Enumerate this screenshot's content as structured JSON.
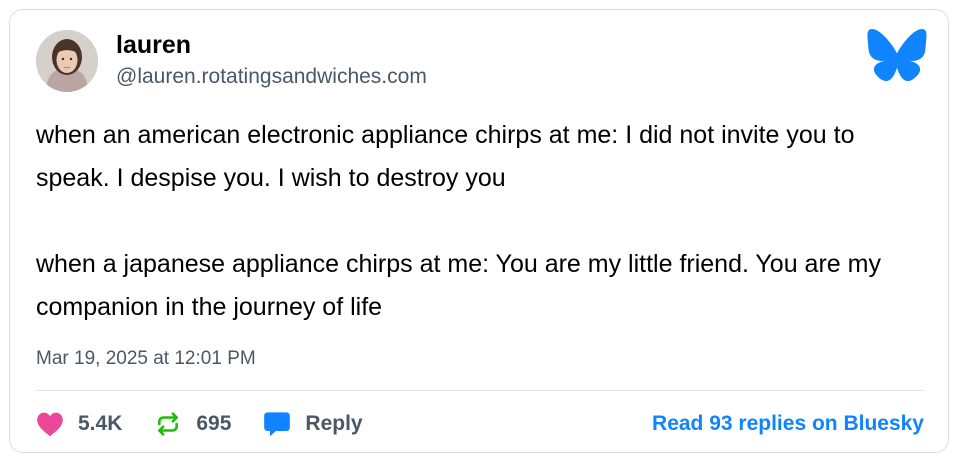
{
  "author": {
    "display_name": "lauren",
    "handle": "@lauren.rotatingsandwiches.com"
  },
  "post": {
    "paragraph_1": "when an american electronic appliance chirps at me: I did not invite you to speak. I despise you. I wish to destroy you",
    "paragraph_2": "when a japanese appliance chirps at me: You are my little friend. You are my companion in the journey of life",
    "timestamp": "Mar 19, 2025 at 12:01 PM"
  },
  "actions": {
    "likes": "5.4K",
    "reposts": "695",
    "reply_label": "Reply",
    "read_replies_label": "Read 93 replies on Bluesky"
  },
  "icons": {
    "brand": "bluesky-butterfly-icon",
    "like": "heart-icon",
    "repost": "repost-icon",
    "reply": "speech-bubble-icon"
  },
  "colors": {
    "brand_blue": "#1083fe",
    "heart_pink": "#ec4899",
    "repost_green": "#20bc07",
    "muted_text": "#4a5866"
  }
}
